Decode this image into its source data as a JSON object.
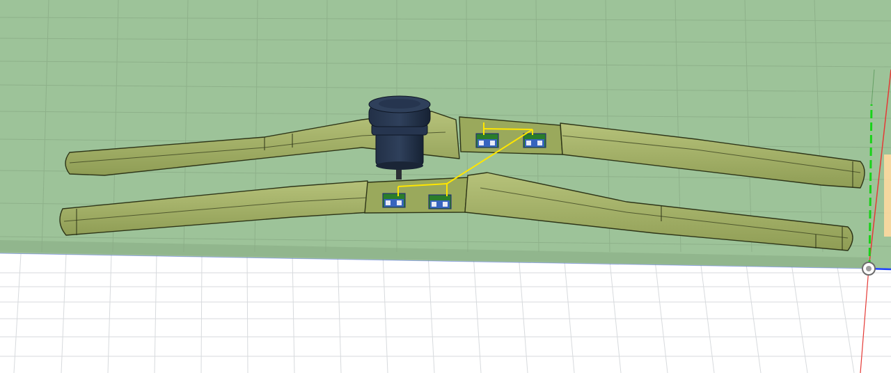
{
  "viewport": {
    "kind": "cad-3d-canvas",
    "colors": {
      "background": "#ffffff",
      "stock_top": "#9cc298",
      "stock_edge": "#8fb08a",
      "grid_minor": "#d6d9dc",
      "grid_on_stock": "#8aa986",
      "part_fill": "#a9b86a",
      "part_dark": "#8c9a4f",
      "part_outline": "#2d3417",
      "tool_body": "#1e2a3c",
      "tool_shank": "#2b2f35",
      "toolpath": "#ffe600",
      "axis_x": "#e53935",
      "axis_y": "#2e7d32",
      "axis_y_dashed": "#19d219",
      "axis_z": "#1e40ff",
      "origin_ring": "#6b6b6b"
    },
    "icons": {
      "origin": "origin-marker-icon",
      "tool": "cutting-tool-icon",
      "fixture": "tab-fixture-icon"
    }
  }
}
